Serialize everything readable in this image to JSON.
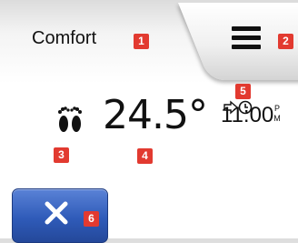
{
  "title": "Comfort",
  "temperature": "24.5°",
  "clock": {
    "time": "11:00",
    "period": "P M",
    "override_icon": "arrow-to-clock-icon"
  },
  "icons": {
    "menu": "menu-hamburger-icon",
    "presence": "footprints-icon",
    "cancel": "close-x-icon"
  },
  "badges": {
    "title": "1",
    "menu": "2",
    "footprints": "3",
    "temperature": "4",
    "clock": "5",
    "cancel": "6"
  },
  "colors": {
    "badge": "#e23a30",
    "cancel_button": "#2f5bb9",
    "text": "#111111"
  }
}
